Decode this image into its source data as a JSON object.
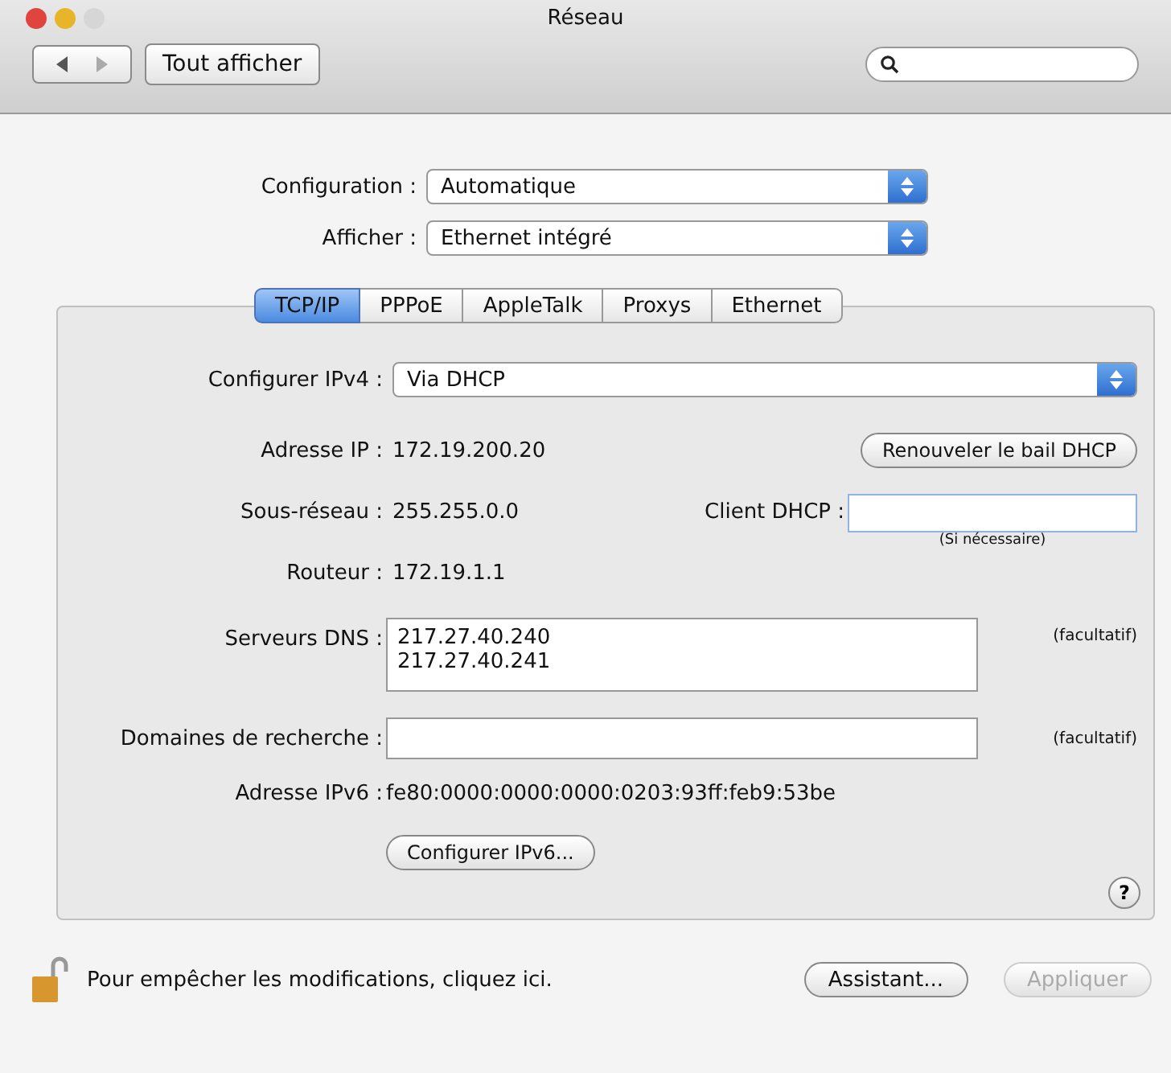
{
  "window": {
    "title": "Réseau"
  },
  "show_all_button": "Tout afficher",
  "config": [
    {
      "label": "Configuration :",
      "value": "Automatique"
    },
    {
      "label": "Afficher :",
      "value": "Ethernet intégré"
    }
  ],
  "tabs": [
    {
      "label": "TCP/IP",
      "selected": true
    },
    {
      "label": "PPPoE",
      "selected": false
    },
    {
      "label": "AppleTalk",
      "selected": false
    },
    {
      "label": "Proxys",
      "selected": false
    },
    {
      "label": "Ethernet",
      "selected": false
    }
  ],
  "ipv4": {
    "label": "Configurer IPv4 :",
    "value": "Via DHCP"
  },
  "ip_address": {
    "label": "Adresse IP :",
    "value": "172.19.200.20"
  },
  "renew_button": "Renouveler le bail DHCP",
  "subnet": {
    "label": "Sous-réseau :",
    "value": "255.255.0.0"
  },
  "dhcp_client": {
    "label": "Client DHCP :",
    "hint": "(Si nécessaire)"
  },
  "router": {
    "label": "Routeur :",
    "value": "172.19.1.1"
  },
  "dns": {
    "label": "Serveurs DNS :",
    "values": [
      "217.27.40.240",
      "217.27.40.241"
    ],
    "note": "(facultatif)"
  },
  "search_domains": {
    "label": "Domaines de recherche :",
    "note": "(facultatif)"
  },
  "ipv6": {
    "label": "Adresse IPv6 :",
    "value": "fe80:0000:0000:0000:0203:93ff:feb9:53be"
  },
  "configure_ipv6_button": "Configurer IPv6...",
  "help_button": "?",
  "footer": {
    "lock_text": "Pour empêcher les modifications, cliquez ici.",
    "buttons": [
      {
        "label": "Assistant...",
        "disabled": false
      },
      {
        "label": "Appliquer",
        "disabled": true
      }
    ]
  }
}
